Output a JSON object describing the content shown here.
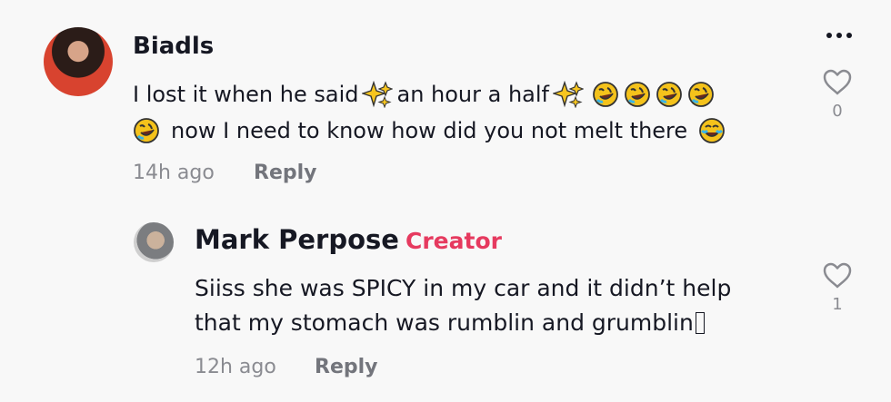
{
  "comments": {
    "top": {
      "username": "Biadls",
      "line1_start": "I lost it when he said",
      "line1_middle": "an hour a half",
      "line2_end": "now I need to know how did you not melt there",
      "time": "14h ago",
      "reply": "Reply",
      "likes": "0",
      "emoji_names": [
        "sparkles-icon",
        "rolling-laughing-icon",
        "joy-icon"
      ]
    },
    "reply": {
      "username": "Mark Perpose",
      "separator": "·",
      "badge": "Creator",
      "line1": "Siiss she was SPICY in my car and it didn’t help",
      "line2": "that my stomach was rumblin and grumblin",
      "time": "12h ago",
      "reply": "Reply",
      "likes": "1"
    }
  },
  "actions": {
    "more_icon": "more-horizontal-icon",
    "heart_icon": "heart-icon"
  },
  "colors": {
    "background": "#f8f8f8",
    "text": "#161823",
    "muted": "#8a8b91",
    "creator": "#e63a5f",
    "emoji": "#f4c21b"
  }
}
